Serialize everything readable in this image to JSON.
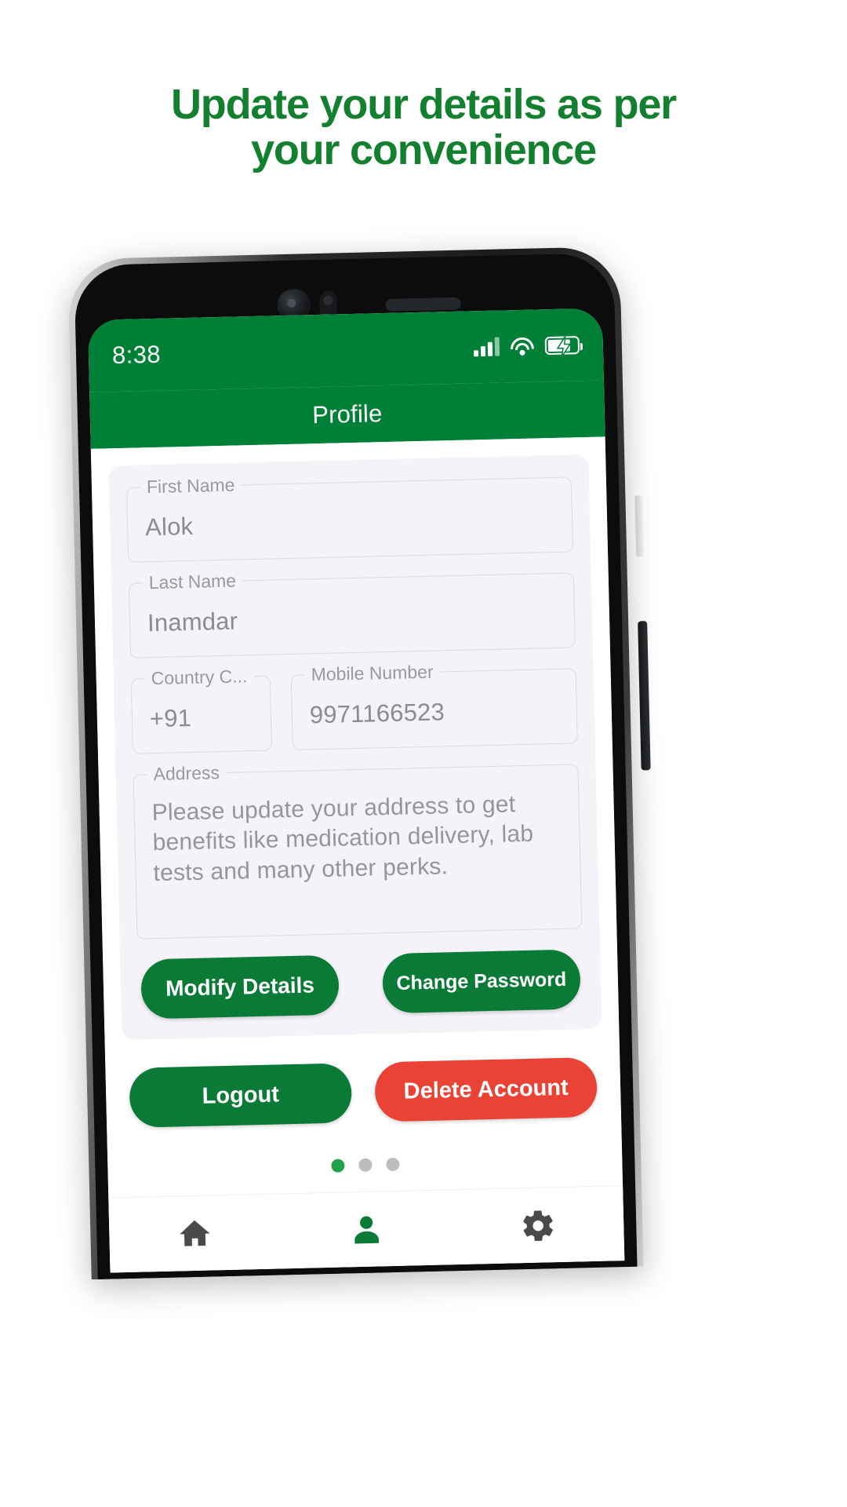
{
  "promo": {
    "line1": "Update your details as per",
    "line2": "your convenience",
    "color": "#13802f"
  },
  "theme": {
    "brand_green": "#008037",
    "button_green": "#0a7a37",
    "danger_red": "#ea4335",
    "card_bg": "#f5f3f8",
    "active_dot": "#22a24a"
  },
  "status_bar": {
    "time": "8:38",
    "signal_icon": "signal-bars-icon",
    "wifi_icon": "wifi-icon",
    "battery_icon": "battery-charging-icon"
  },
  "appbar": {
    "title": "Profile"
  },
  "form": {
    "first_name": {
      "label": "First Name",
      "value": "Alok"
    },
    "last_name": {
      "label": "Last Name",
      "value": "Inamdar"
    },
    "country_code": {
      "label": "Country C...",
      "value": "+91"
    },
    "mobile_number": {
      "label": "Mobile Number",
      "value": "9971166523"
    },
    "address": {
      "label": "Address",
      "placeholder": "Please update your address to get benefits like medication delivery, lab tests and many other perks."
    }
  },
  "buttons": {
    "modify_details": "Modify Details",
    "change_password": "Change Password",
    "logout": "Logout",
    "delete_account": "Delete Account"
  },
  "pager": {
    "total": 3,
    "active_index": 0
  },
  "bottom_nav": {
    "items": [
      {
        "icon": "home-icon",
        "active": false
      },
      {
        "icon": "person-icon",
        "active": true
      },
      {
        "icon": "gear-icon",
        "active": false
      }
    ]
  }
}
